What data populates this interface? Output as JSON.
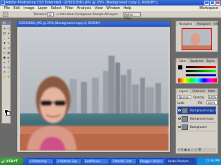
{
  "window": {
    "title": "Adobe Photoshop CS3 Extended - [DSC03061.JPG @ 25% (Background copy 2, RGB/8*)]"
  },
  "menu": {
    "items": [
      "File",
      "Edit",
      "Image",
      "Layer",
      "Select",
      "Filter",
      "Analysis",
      "View",
      "Window",
      "Help"
    ],
    "workspace": "Workspace"
  },
  "options": {
    "tolerance_label": "Tolerance:",
    "tolerance_value": "32",
    "anti_alias": "Anti-alias",
    "contiguous": "Contiguous",
    "sample_all_layers": "Sample All Layers",
    "refine_edge": "Refine Edge..."
  },
  "toolbox": {
    "header": "Ps"
  },
  "document": {
    "title": "DSC03061.JPG @ 25% (Background copy 2, RGB/8*)"
  },
  "navigator": {
    "tabs": [
      "Navigator",
      "Histogram",
      "Info"
    ]
  },
  "color": {
    "tabs": [
      "Color",
      "Swatches",
      "Styles"
    ]
  },
  "layers": {
    "tabs": [
      "Layers",
      "Channels",
      "Paths"
    ],
    "blend_mode": "Normal",
    "opacity_label": "Opacity:",
    "opacity_value": "100%",
    "lock_label": "Lock:",
    "fill_label": "Fill:",
    "fill_value": "100%",
    "rows": [
      {
        "label": "Background copy 2"
      },
      {
        "label": "Background copy"
      },
      {
        "label": "Background"
      }
    ]
  },
  "taskbar": {
    "start_label": "start",
    "tasks": [
      "4 Photoshop",
      "2 Outlook Exp...",
      "SwiftPinion...",
      "3 Mozilla Firef...",
      "Blogger: Daniel..."
    ],
    "active_task": "Adobe Photosh...",
    "clock": "11:36 PM"
  },
  "colors": {
    "accent": "#2456c4",
    "chrome": "#d4d0c8",
    "start_green": "#2a8a2a",
    "selected_layer": "#1f3f98"
  }
}
